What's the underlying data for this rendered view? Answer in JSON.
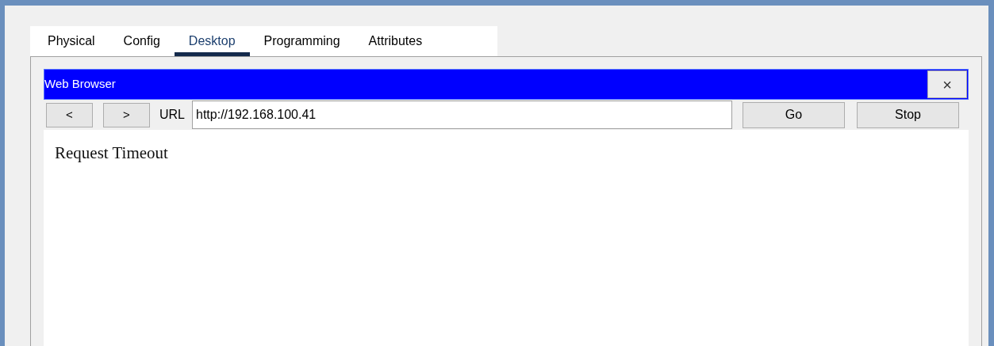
{
  "tabs": [
    {
      "label": "Physical",
      "selected": false
    },
    {
      "label": "Config",
      "selected": false
    },
    {
      "label": "Desktop",
      "selected": true
    },
    {
      "label": "Programming",
      "selected": false
    },
    {
      "label": "Attributes",
      "selected": false
    }
  ],
  "browser": {
    "title": "Web Browser",
    "close": "×",
    "back": "<",
    "forward": ">",
    "url_label": "URL",
    "url": "http://192.168.100.41",
    "go": "Go",
    "stop": "Stop",
    "content": "Request Timeout"
  }
}
